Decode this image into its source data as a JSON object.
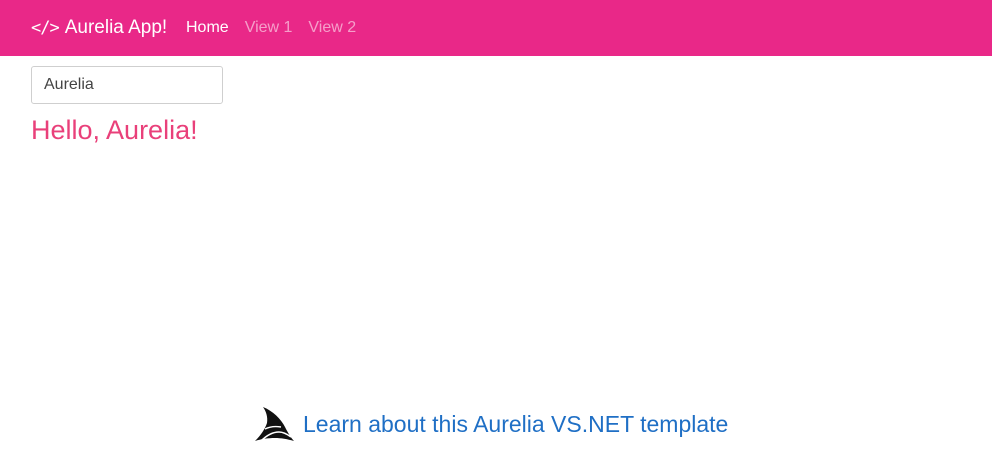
{
  "navbar": {
    "brand_icon": "</>",
    "brand_label": "Aurelia App!",
    "links": [
      {
        "label": "Home",
        "active": true
      },
      {
        "label": "View 1",
        "active": false
      },
      {
        "label": "View 2",
        "active": false
      }
    ],
    "background_color": "#e92888"
  },
  "main": {
    "name_input_value": "Aurelia",
    "greeting": "Hello, Aurelia!",
    "greeting_color": "#e9407a"
  },
  "footer": {
    "icon": "fin-logo-icon",
    "link_text": "Learn about this Aurelia VS.NET template",
    "link_color": "#1f6fc5"
  }
}
